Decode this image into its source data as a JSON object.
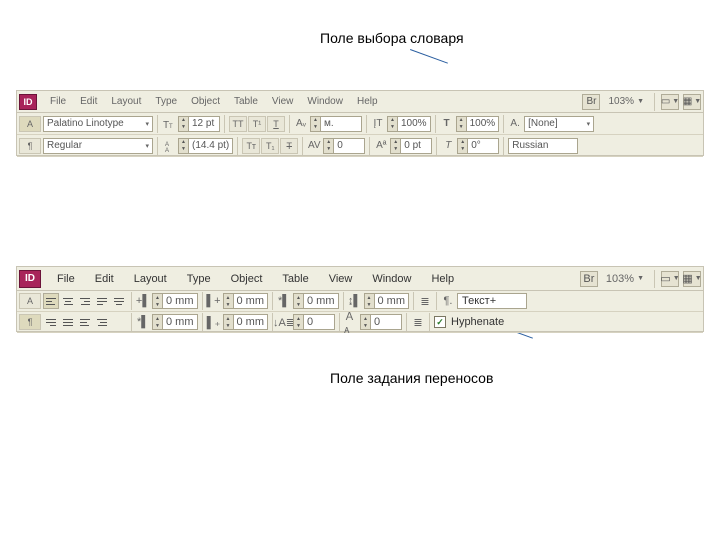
{
  "captions": {
    "dictionary": "Поле выбора словаря",
    "hyphenation": "Поле задания переносов"
  },
  "top": {
    "app": "ID",
    "menus": [
      "File",
      "Edit",
      "Layout",
      "Type",
      "Object",
      "Table",
      "View",
      "Window",
      "Help"
    ],
    "zoom": "103%",
    "row1": {
      "font": "Palatino Linotype",
      "size": "12 pt",
      "vscale": "100%",
      "hscale": "100%",
      "charstyle": "[None]"
    },
    "row2": {
      "style": "Regular",
      "leading": "(14.4 pt)",
      "tracking": "0",
      "baseline": "0 pt",
      "skew": "0°",
      "lang": "Russian"
    }
  },
  "bottom": {
    "app": "ID",
    "menus": [
      "File",
      "Edit",
      "Layout",
      "Type",
      "Object",
      "Table",
      "View",
      "Window",
      "Help"
    ],
    "zoom": "103%",
    "row1": {
      "left_indent": "0 mm",
      "right_indent": "0 mm",
      "space_before": "0 mm",
      "drop_lines": "0 mm",
      "parastyle": "Текст+"
    },
    "row2": {
      "first_indent": "0 mm",
      "last_indent": "0 mm",
      "space_after": "0",
      "drop_chars": "0",
      "hyphenate": "Hyphenate"
    }
  }
}
